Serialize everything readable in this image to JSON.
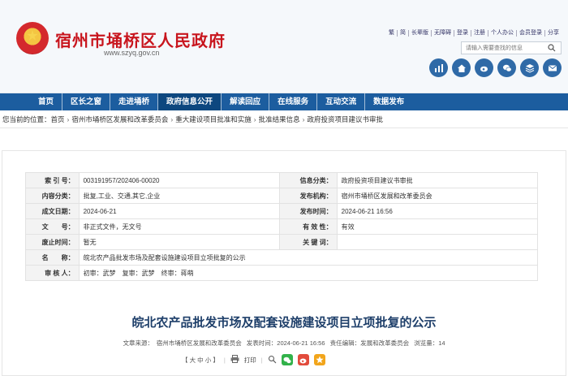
{
  "header": {
    "site_title": "宿州市埇桥区人民政府",
    "site_url": "www.szyq.gov.cn",
    "top_links": [
      "繁",
      "简",
      "长辈版",
      "无障碍",
      "登录",
      "注册",
      "个人办公",
      "会员登录",
      "分享"
    ],
    "search_placeholder": "请输入需要查找的信息",
    "icons": [
      "chart-icon",
      "home-icon",
      "weibo-icon",
      "wechat-icon",
      "layers-icon",
      "mail-icon"
    ]
  },
  "nav": {
    "items": [
      "首页",
      "区长之窗",
      "走进埇桥",
      "政府信息公开",
      "解读回应",
      "在线服务",
      "互动交流",
      "数据发布"
    ],
    "active_index": 3
  },
  "breadcrumb": {
    "prefix": "您当前的位置：",
    "items": [
      "首页",
      "宿州市埇桥区发展和改革委员会",
      "重大建设项目批准和实施",
      "批准结果信息",
      "政府投资项目建议书审批"
    ]
  },
  "meta": {
    "index_label": "索 引 号：",
    "index_value": "003191957/202406-00020",
    "info_class_label": "信息分类：",
    "info_class_value": "政府投资项目建议书审批",
    "category_label": "内容分类：",
    "category_value": "批复,工业、交通,其它,企业",
    "publisher_label": "发布机构：",
    "publisher_value": "宿州市埇桥区发展和改革委员会",
    "created_label": "成文日期：",
    "created_value": "2024-06-21",
    "published_label": "发布时间：",
    "published_value": "2024-06-21 16:56",
    "docno_label": "文　　号：",
    "docno_value": "非正式文件，无文号",
    "validity_label": "有 效 性：",
    "validity_value": "有效",
    "abolish_label": "废止时间：",
    "abolish_value": "暂无",
    "keywords_label": "关 键 词：",
    "keywords_value": "",
    "name_label": "名　　称：",
    "name_value": "皖北农产品批发市场及配套设施建设项目立项批复的公示",
    "reviewer_label": "审 核 人：",
    "reviewer_value": "初审：武梦　复审：武梦　终审：蒋萌"
  },
  "article": {
    "title": "皖北农产品批发市场及配套设施建设项目立项批复的公示",
    "source": "文章来源：　宿州市埇桥区发展和改革委员会",
    "time": "发表时间：2024-06-21 16:56",
    "editor": "责任编辑：发展和改革委员会",
    "views": "浏览量：14",
    "font_size": "【 大  中  小 】",
    "print": "打印"
  },
  "colors": {
    "brand_red": "#c8151d",
    "nav_blue": "#1c5d9f",
    "nav_active": "#0d477f",
    "title_blue": "#1e3f6a"
  }
}
